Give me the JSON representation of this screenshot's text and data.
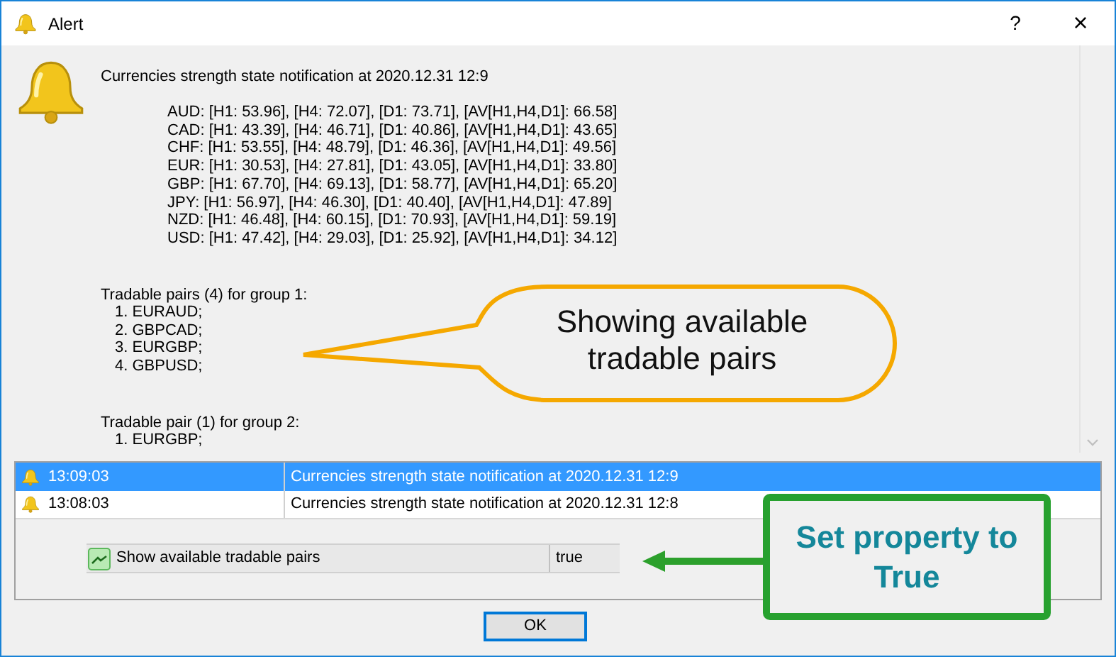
{
  "window": {
    "title": "Alert",
    "help": "?",
    "close": "×"
  },
  "message": {
    "heading": "Currencies strength state notification at 2020.12.31 12:9",
    "strength_lines": [
      "AUD: [H1: 53.96], [H4: 72.07], [D1: 73.71], [AV[H1,H4,D1]: 66.58]",
      "CAD: [H1: 43.39], [H4: 46.71], [D1: 40.86], [AV[H1,H4,D1]: 43.65]",
      "CHF: [H1: 53.55], [H4: 48.79], [D1: 46.36], [AV[H1,H4,D1]: 49.56]",
      "EUR: [H1: 30.53], [H4: 27.81], [D1: 43.05], [AV[H1,H4,D1]: 33.80]",
      "GBP: [H1: 67.70], [H4: 69.13], [D1: 58.77], [AV[H1,H4,D1]: 65.20]",
      "JPY: [H1: 56.97], [H4: 46.30], [D1: 40.40], [AV[H1,H4,D1]: 47.89]",
      "NZD: [H1: 46.48], [H4: 60.15], [D1: 70.93], [AV[H1,H4,D1]: 59.19]",
      "USD: [H1: 47.42], [H4: 29.03], [D1: 25.92], [AV[H1,H4,D1]: 34.12]"
    ],
    "groups": [
      {
        "title": "Tradable pairs (4) for group 1:",
        "items": [
          "1. EURAUD;",
          "2. GBPCAD;",
          "3. EURGBP;",
          "4. GBPUSD;"
        ]
      },
      {
        "title": "Tradable pair (1) for group 2:",
        "items": [
          "1. EURGBP;"
        ]
      }
    ]
  },
  "alerts": [
    {
      "time": "13:09:03",
      "message": "Currencies strength state notification at 2020.12.31 12:9",
      "selected": true
    },
    {
      "time": "13:08:03",
      "message": "Currencies strength state notification at 2020.12.31 12:8",
      "selected": false
    }
  ],
  "property": {
    "label": "Show available tradable pairs",
    "value": "true"
  },
  "callouts": [
    {
      "kind": "bubble",
      "text": "Showing available tradable pairs"
    },
    {
      "kind": "box",
      "text": "Set property to True"
    }
  ],
  "buttons": [
    "OK"
  ]
}
